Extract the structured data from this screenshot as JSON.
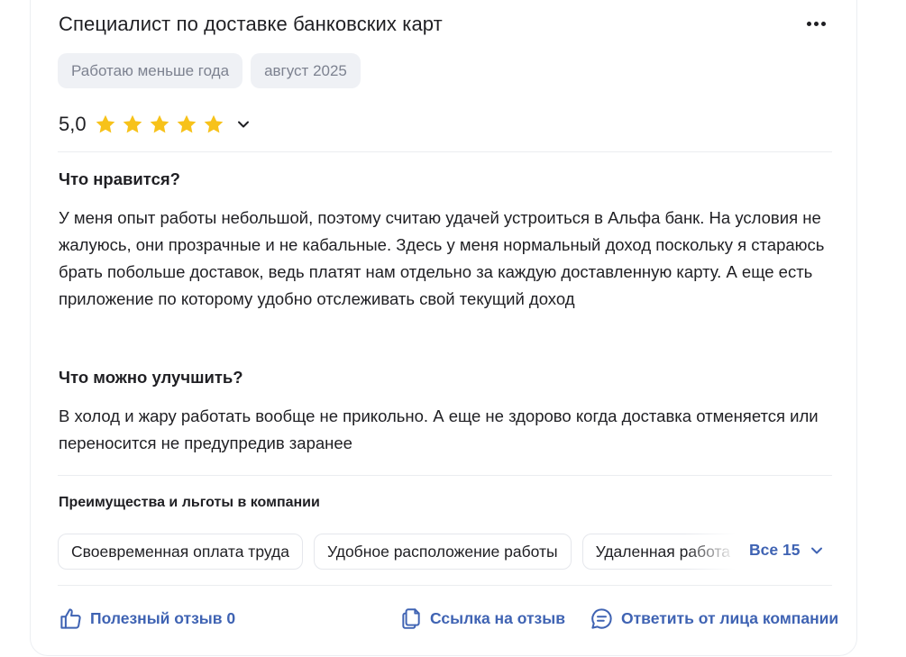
{
  "review": {
    "title": "Специалист по доставке банковских карт",
    "tags": [
      "Работаю меньше года",
      "август 2025"
    ],
    "rating": "5,0",
    "rating_stars": 5,
    "likes": {
      "heading": "Что нравится?",
      "text": "У меня опыт работы небольшой, поэтому считаю удачей устроиться в Альфа банк. На условия не жалуюсь, они прозрачные и не кабальные. Здесь у меня нормальный доход поскольку я стараюсь брать побольше доставок, ведь платят нам отдельно за каждую доставленную карту. А еще есть приложение по которому удобно отслеживать свой текущий доход"
    },
    "improve": {
      "heading": "Что можно улучшить?",
      "text": "В холод и жару работать вообще не прикольно. А еще не здорово когда доставка отменяется или переносится не предупредив заранее"
    },
    "benefits": {
      "heading": "Преимущества и льготы в компании",
      "chips": [
        "Своевременная оплата труда",
        "Удобное расположение работы",
        "Удаленная работа"
      ],
      "all_label": "Все 15"
    },
    "actions": {
      "helpful": "Полезный отзыв 0",
      "link": "Ссылка на отзыв",
      "reply": "Ответить от лица компании"
    }
  },
  "colors": {
    "accent": "#3f63b3",
    "star": "#f7c21a",
    "tag_bg": "#eff1f5"
  }
}
